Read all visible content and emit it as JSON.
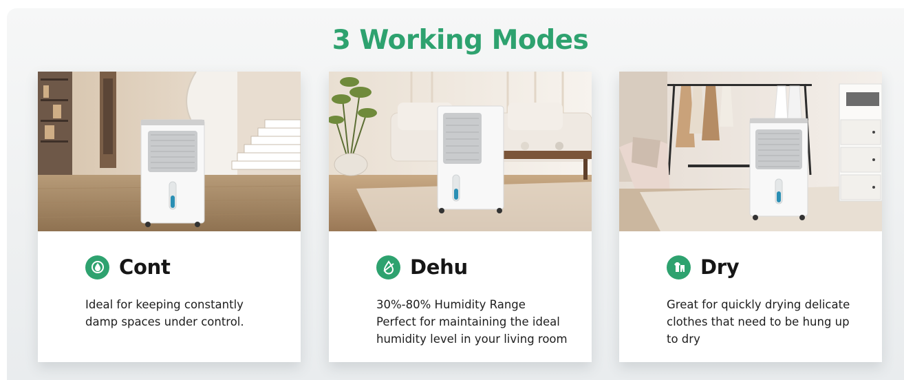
{
  "header": {
    "title": "3 Working Modes"
  },
  "colors": {
    "accent": "#2ea26f",
    "text": "#161616"
  },
  "modes": [
    {
      "name": "Cont",
      "icon": "continuous-drain-icon",
      "lines": [
        "Ideal for keeping constantly",
        "damp spaces under control."
      ]
    },
    {
      "name": "Dehu",
      "icon": "water-drop-icon",
      "lines": [
        "30%-80% Humidity Range",
        "Perfect for maintaining the ideal",
        "humidity level in your living room"
      ]
    },
    {
      "name": "Dry",
      "icon": "hanging-clothes-icon",
      "lines": [
        "Great for quickly drying delicate",
        "clothes that need to be hung up",
        "to dry"
      ]
    }
  ]
}
